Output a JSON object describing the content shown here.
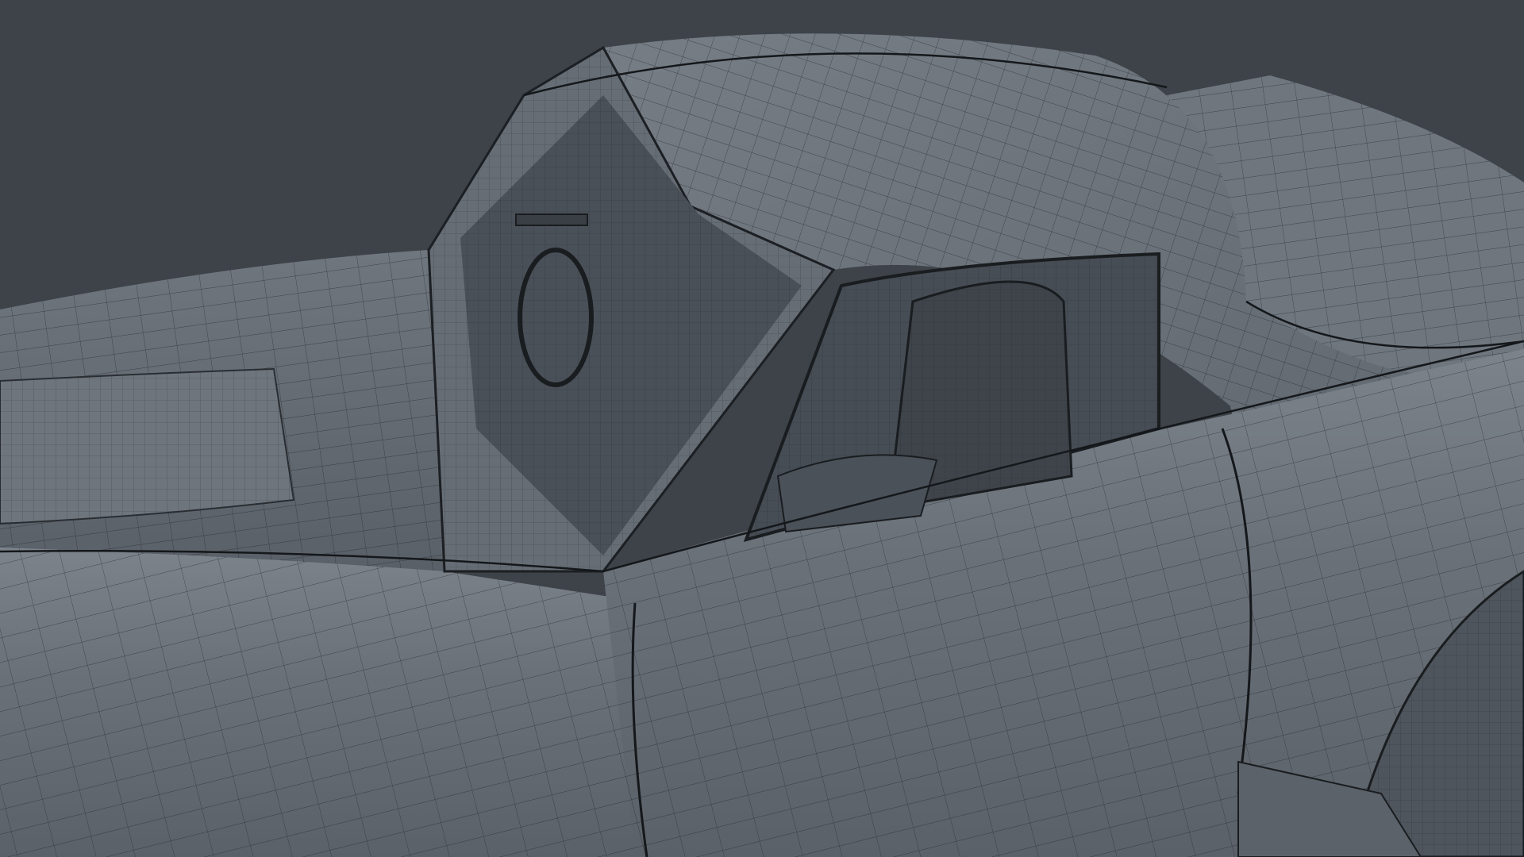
{
  "viewport": {
    "background_color": "#3e4349",
    "subject": "car-body-wireframe",
    "colors": {
      "body_light": "#8a9199",
      "body_mid": "#737a83",
      "body_dark": "#555c64",
      "interior": "#4a5058",
      "wire": "#1e2226"
    }
  }
}
